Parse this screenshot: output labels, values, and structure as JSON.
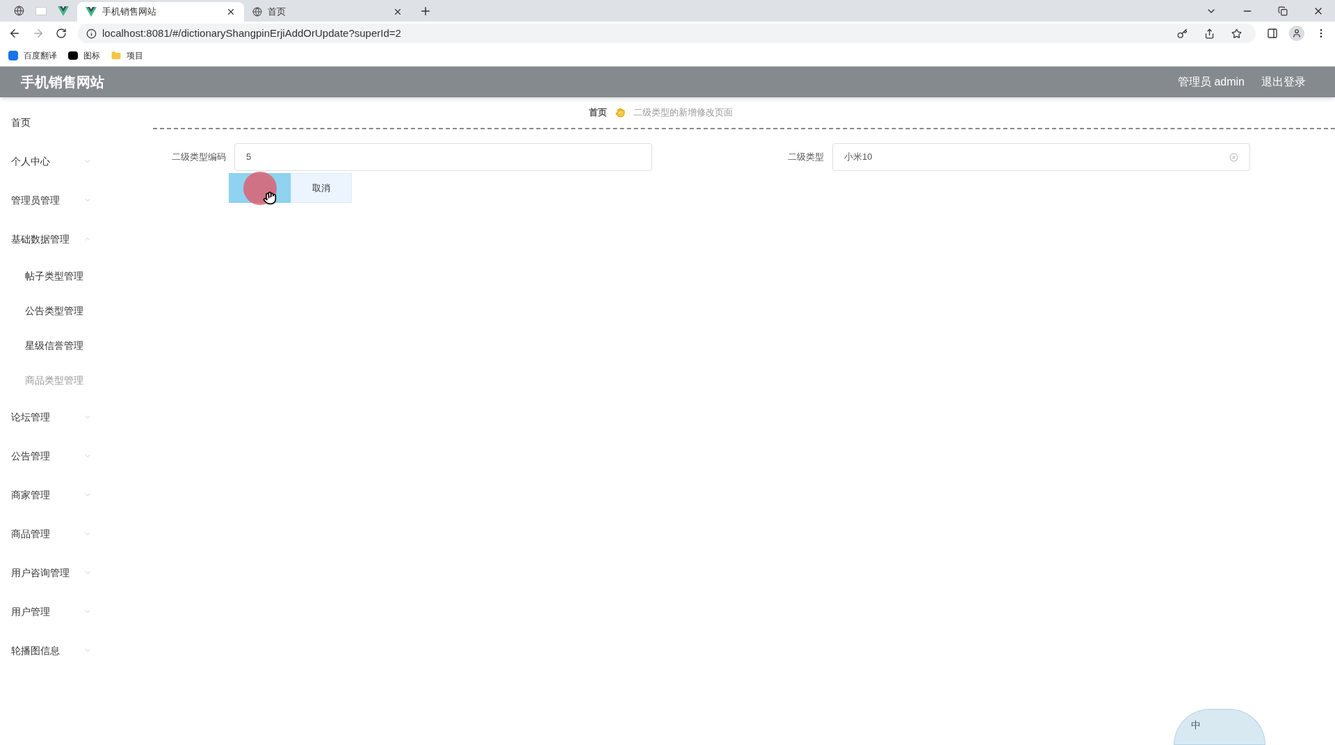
{
  "browser": {
    "tabs": [
      {
        "title": "手机销售网站",
        "selected": true
      },
      {
        "title": "首页",
        "selected": false
      }
    ],
    "url": "localhost:8081/#/dictionaryShangpinErjiAddOrUpdate?superId=2",
    "bookmarks": [
      "百度翻译",
      "图标",
      "项目"
    ]
  },
  "header": {
    "title": "手机销售网站",
    "user": "管理员 admin",
    "logout": "退出登录"
  },
  "sidebar": {
    "items": [
      {
        "label": "首页"
      },
      {
        "label": "个人中心",
        "expanded": false
      },
      {
        "label": "管理员管理",
        "expanded": false
      },
      {
        "label": "基础数据管理",
        "expanded": true,
        "children": [
          {
            "label": "帖子类型管理",
            "selected": false
          },
          {
            "label": "公告类型管理",
            "selected": false
          },
          {
            "label": "星级信誉管理",
            "selected": false
          },
          {
            "label": "商品类型管理",
            "selected": true
          }
        ]
      },
      {
        "label": "论坛管理",
        "expanded": false
      },
      {
        "label": "公告管理",
        "expanded": false
      },
      {
        "label": "商家管理",
        "expanded": false
      },
      {
        "label": "商品管理",
        "expanded": false
      },
      {
        "label": "用户咨询管理",
        "expanded": false
      },
      {
        "label": "用户管理",
        "expanded": false
      },
      {
        "label": "轮播图信息",
        "expanded": false
      }
    ]
  },
  "breadcrumb": {
    "home": "首页",
    "current": "二级类型的新增修改页面"
  },
  "form": {
    "fields": [
      {
        "label": "二级类型编码",
        "value": "5"
      },
      {
        "label": "二级类型",
        "value": "小米10"
      }
    ],
    "cancel": "取消"
  },
  "ime": {
    "label": "中"
  }
}
